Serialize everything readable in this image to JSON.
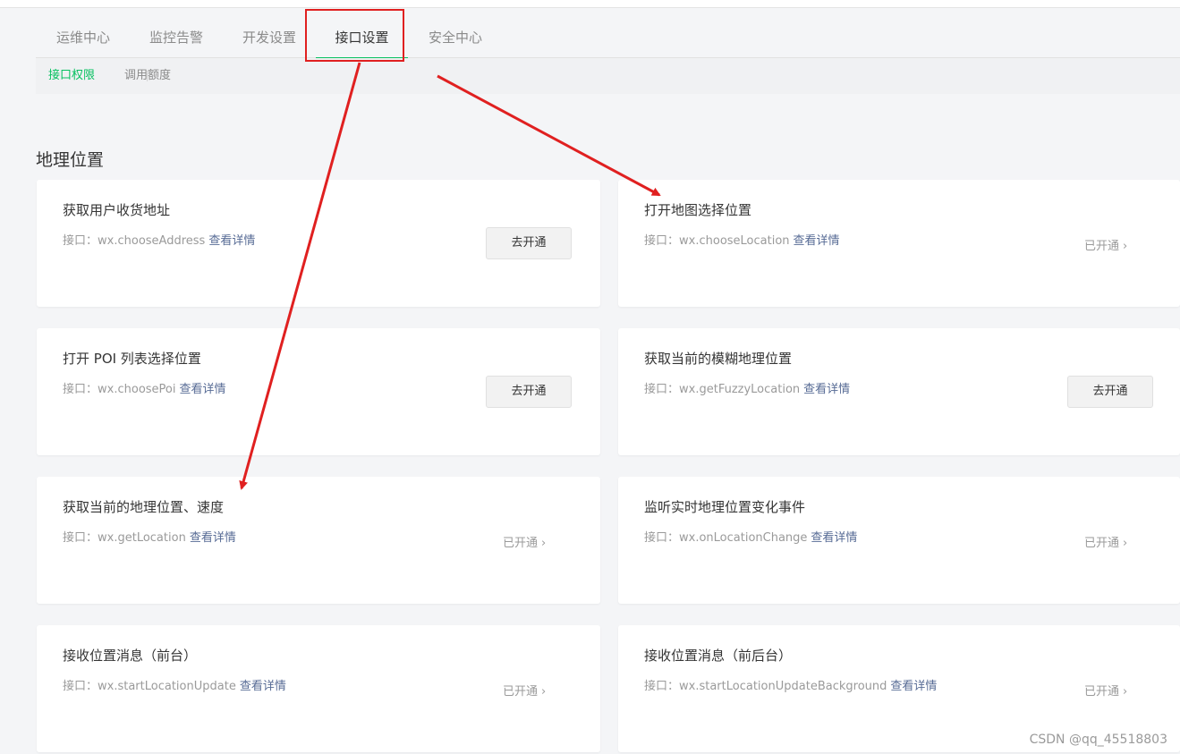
{
  "tabs": [
    {
      "label": "运维中心"
    },
    {
      "label": "监控告警"
    },
    {
      "label": "开发设置"
    },
    {
      "label": "接口设置"
    },
    {
      "label": "安全中心"
    }
  ],
  "subtabs": [
    {
      "label": "接口权限"
    },
    {
      "label": "调用额度"
    }
  ],
  "section_title": "地理位置",
  "api_prefix": "接口：",
  "detail_link": "查看详情",
  "open_button": "去开通",
  "opened_status": "已开通",
  "chevron": "›",
  "cards": [
    {
      "name": "获取用户收货地址",
      "api": "wx.chooseAddress",
      "state": "closed"
    },
    {
      "name": "打开地图选择位置",
      "api": "wx.chooseLocation",
      "state": "open"
    },
    {
      "name": "打开 POI 列表选择位置",
      "api": "wx.choosePoi",
      "state": "closed"
    },
    {
      "name": "获取当前的模糊地理位置",
      "api": "wx.getFuzzyLocation",
      "state": "closed"
    },
    {
      "name": "获取当前的地理位置、速度",
      "api": "wx.getLocation",
      "state": "open"
    },
    {
      "name": "监听实时地理位置变化事件",
      "api": "wx.onLocationChange",
      "state": "open"
    },
    {
      "name": "接收位置消息（前台）",
      "api": "wx.startLocationUpdate",
      "state": "open"
    },
    {
      "name": "接收位置消息（前后台）",
      "api": "wx.startLocationUpdateBackground",
      "state": "open"
    }
  ],
  "watermark": "CSDN @qq_45518803",
  "colors": {
    "accent": "#07c160",
    "link": "#576b95",
    "annotation": "#e02020"
  }
}
